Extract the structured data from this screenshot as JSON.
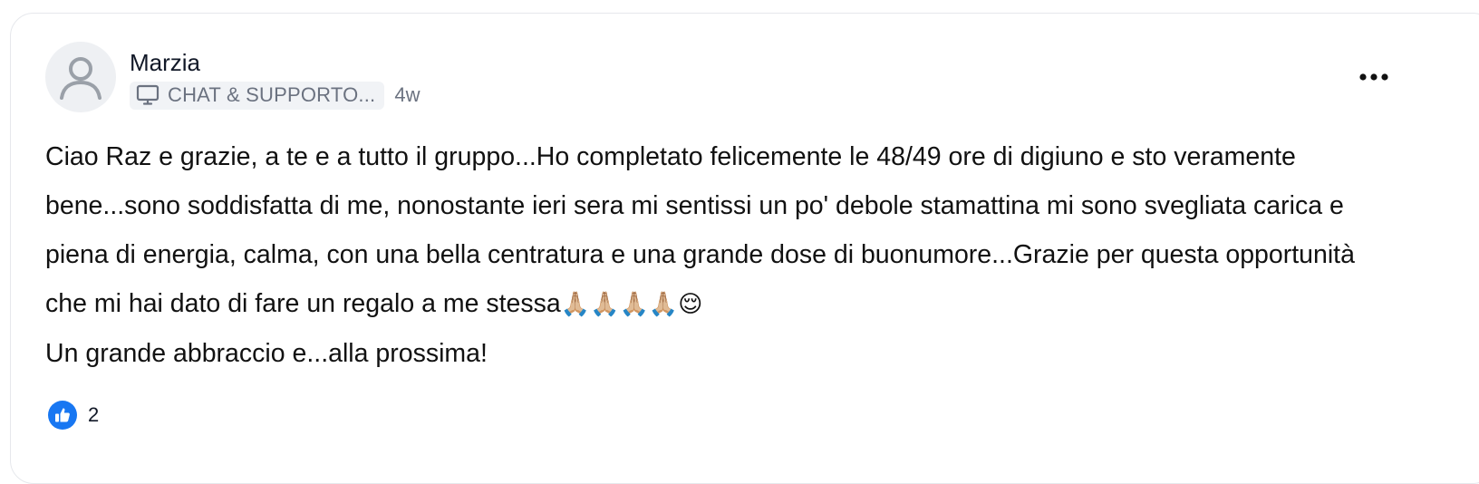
{
  "post": {
    "author": "Marzia",
    "category": "CHAT & SUPPORTO...",
    "time": "4w",
    "body": {
      "paragraph": "Ciao Raz e grazie, a te e a tutto il gruppo...Ho completato felicemente le 48/49 ore di digiuno e sto veramente bene...sono soddisfatta di me, nonostante ieri sera mi sentissi un po' debole stamattina mi sono svegliata carica e piena di energia, calma, con una bella centratura e una grande dose di buonumore...Grazie per questa opportunità che mi hai dato di fare un regalo a me stessa",
      "emojis": "🙏🏼🙏🏼🙏🏼🙏🏼😌",
      "closing": "Un grande abbraccio e...alla prossima!"
    },
    "reactions": {
      "like_count": "2"
    }
  },
  "icons": {
    "avatar": "default-user-avatar",
    "category": "monitor-icon",
    "menu": "more-horizontal-icon",
    "like": "thumbs-up-icon"
  },
  "colors": {
    "like_blue": "#1877f2",
    "muted_text": "#6b7280",
    "tag_bg": "#f1f3f6",
    "avatar_bg": "#eef0f3"
  }
}
